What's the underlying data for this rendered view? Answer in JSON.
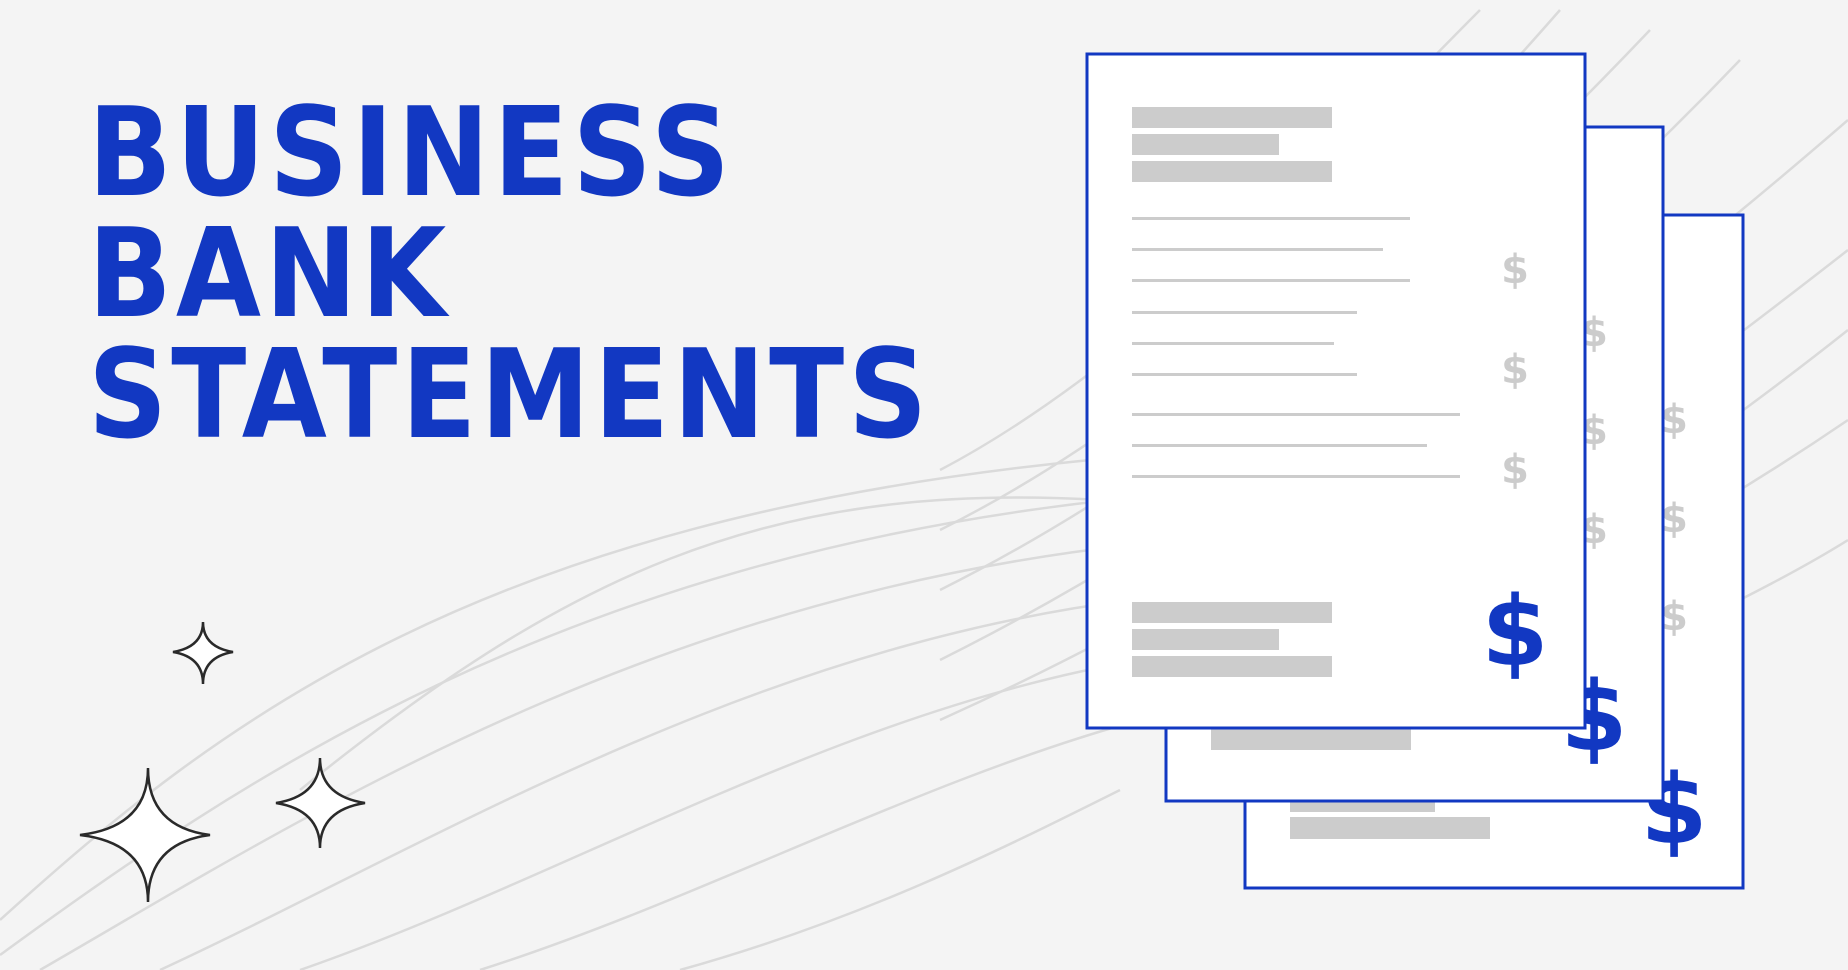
{
  "headline": {
    "line1": "BUSINESS",
    "line2": "BANK",
    "line3": "STATEMENTS"
  },
  "colors": {
    "background": "#f4f4f4",
    "brand_blue": "#1238c2",
    "placeholder_gray": "#cccccc",
    "wave_line": "#dadada",
    "sparkle_outline": "#2a2a2a"
  },
  "icons": {
    "document_stack": "document-stack-icon",
    "currency": "dollar-sign-icon",
    "sparkle": "sparkle-icon"
  },
  "documents": {
    "currency_symbol": "$"
  }
}
